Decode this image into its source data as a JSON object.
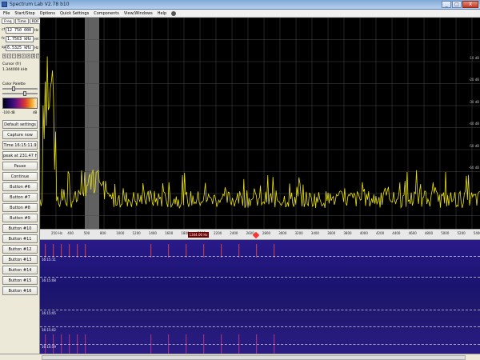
{
  "window": {
    "title": "Spectrum Lab V2.78 b10",
    "buttons": {
      "minimize": "_",
      "maximize": "□",
      "close": "X"
    }
  },
  "menu": {
    "items": [
      "File",
      "Start/Stop",
      "Options",
      "Quick Settings",
      "Components",
      "View/Windows",
      "Help"
    ]
  },
  "left_panel": {
    "tabs": [
      "Freq",
      "Time",
      "RDF"
    ],
    "frequency_rows": [
      {
        "label": "cf",
        "value": "12 750 000",
        "unit": "Hz"
      },
      {
        "label": "fc",
        "value": "1.7563 kHz",
        "unit": "rel"
      },
      {
        "label": "sp",
        "value": "6.5325 kHz",
        "unit": "Hz"
      }
    ],
    "stepper_symbols": [
      "«",
      "‹",
      "-",
      "+",
      "›",
      "»",
      "↕",
      "?"
    ],
    "cursor_label": "Cursor (fr)",
    "cursor_value": "1.344000 kHz",
    "color_palette_label": "Color Palette",
    "palette_low": "-100 dB",
    "palette_high": "dB",
    "palette_slider": {
      "brightness": 0.3,
      "contrast": 0.65
    },
    "buttons": [
      "Default settings",
      "Capture now",
      "Time 16:15:11.9",
      "peak at 231.47 Hz",
      "Pause",
      "Continue",
      "Button #6",
      "Button #7",
      "Button #8",
      "Button #9",
      "Button #10",
      "Button #11",
      "Button #12",
      "Button #13",
      "Button #14",
      "Button #15",
      "Button #16"
    ]
  },
  "spectrum": {
    "y_labels": [
      "-10 dB",
      "-20 dB",
      "-30 dB",
      "-40 dB",
      "-50 dB",
      "-60 dB"
    ],
    "grid_color": "#4a4a4a",
    "trace_color": "#e8e010",
    "highlight_band_color": "#888888"
  },
  "freq_axis": {
    "tick_labels": [
      "250 Hz",
      "400",
      "500",
      "800",
      "1000",
      "1200",
      "1400",
      "1600",
      "1800",
      "2000",
      "2200",
      "2400",
      "2600",
      "2800",
      "3000",
      "3200",
      "3400",
      "3600",
      "3800",
      "4000",
      "4200",
      "4400",
      "4600",
      "4800",
      "5000",
      "5200",
      "5400"
    ],
    "marker_text": "1344.00 Hz"
  },
  "waterfall": {
    "time_labels": [
      "16:15:11",
      "16:15:08",
      "16:15:05",
      "16:15:02",
      "16:14:59"
    ]
  }
}
